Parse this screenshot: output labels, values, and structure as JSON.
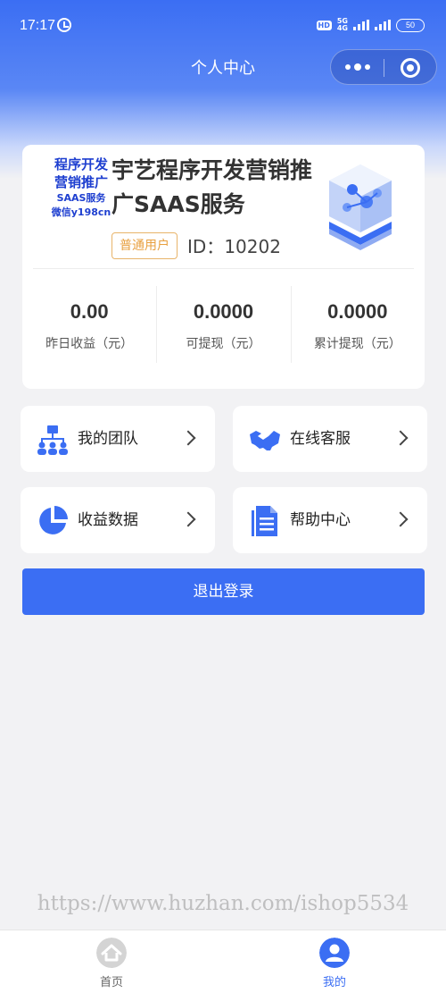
{
  "status_bar": {
    "time": "17:17",
    "hd": "HD",
    "network_top": "5G",
    "network_bottom": "4G",
    "battery": "50"
  },
  "nav": {
    "title": "个人中心"
  },
  "profile": {
    "logo_lines": [
      "程序开发",
      "营销推广",
      "SAAS服务",
      "微信y198cn"
    ],
    "name": "宇艺程序开发营销推广SAAS服务",
    "role": "普通用户",
    "id_label": "ID：",
    "id_value": "10202",
    "stats": [
      {
        "value": "0.00",
        "label": "昨日收益（元）"
      },
      {
        "value": "0.0000",
        "label": "可提现（元）"
      },
      {
        "value": "0.0000",
        "label": "累计提现（元）"
      }
    ]
  },
  "menu": [
    {
      "label": "我的团队",
      "icon": "team-icon"
    },
    {
      "label": "在线客服",
      "icon": "handshake-icon"
    },
    {
      "label": "收益数据",
      "icon": "pie-chart-icon"
    },
    {
      "label": "帮助中心",
      "icon": "document-icon"
    }
  ],
  "logout_label": "退出登录",
  "watermark": "https://www.huzhan.com/ishop5534",
  "tabs": [
    {
      "label": "首页",
      "icon": "home-icon",
      "active": false
    },
    {
      "label": "我的",
      "icon": "user-icon",
      "active": true
    }
  ],
  "colors": {
    "primary": "#3b6ef3",
    "badge": "#e8a040",
    "logo_text": "#1e3fd0"
  }
}
